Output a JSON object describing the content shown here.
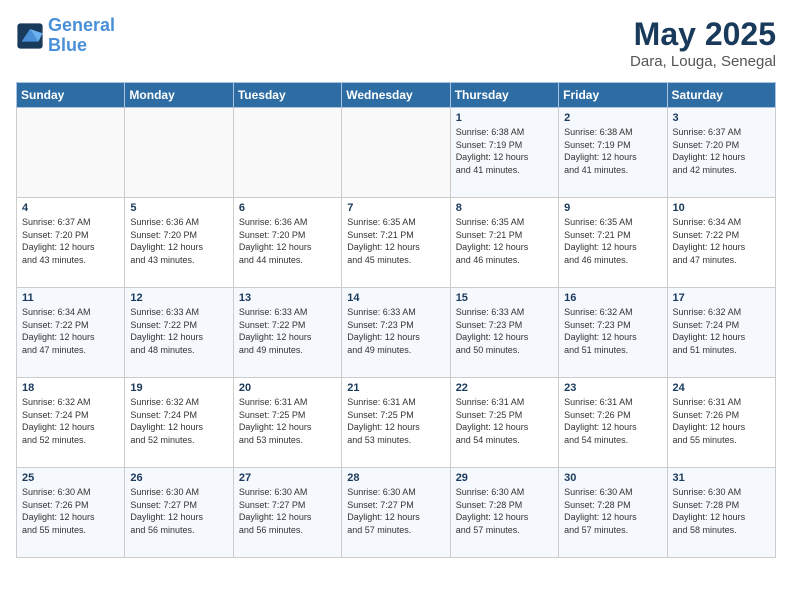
{
  "header": {
    "logo_line1": "General",
    "logo_line2": "Blue",
    "title": "May 2025",
    "subtitle": "Dara, Louga, Senegal"
  },
  "days_of_week": [
    "Sunday",
    "Monday",
    "Tuesday",
    "Wednesday",
    "Thursday",
    "Friday",
    "Saturday"
  ],
  "weeks": [
    [
      {
        "day": "",
        "info": ""
      },
      {
        "day": "",
        "info": ""
      },
      {
        "day": "",
        "info": ""
      },
      {
        "day": "",
        "info": ""
      },
      {
        "day": "1",
        "info": "Sunrise: 6:38 AM\nSunset: 7:19 PM\nDaylight: 12 hours\nand 41 minutes."
      },
      {
        "day": "2",
        "info": "Sunrise: 6:38 AM\nSunset: 7:19 PM\nDaylight: 12 hours\nand 41 minutes."
      },
      {
        "day": "3",
        "info": "Sunrise: 6:37 AM\nSunset: 7:20 PM\nDaylight: 12 hours\nand 42 minutes."
      }
    ],
    [
      {
        "day": "4",
        "info": "Sunrise: 6:37 AM\nSunset: 7:20 PM\nDaylight: 12 hours\nand 43 minutes."
      },
      {
        "day": "5",
        "info": "Sunrise: 6:36 AM\nSunset: 7:20 PM\nDaylight: 12 hours\nand 43 minutes."
      },
      {
        "day": "6",
        "info": "Sunrise: 6:36 AM\nSunset: 7:20 PM\nDaylight: 12 hours\nand 44 minutes."
      },
      {
        "day": "7",
        "info": "Sunrise: 6:35 AM\nSunset: 7:21 PM\nDaylight: 12 hours\nand 45 minutes."
      },
      {
        "day": "8",
        "info": "Sunrise: 6:35 AM\nSunset: 7:21 PM\nDaylight: 12 hours\nand 46 minutes."
      },
      {
        "day": "9",
        "info": "Sunrise: 6:35 AM\nSunset: 7:21 PM\nDaylight: 12 hours\nand 46 minutes."
      },
      {
        "day": "10",
        "info": "Sunrise: 6:34 AM\nSunset: 7:22 PM\nDaylight: 12 hours\nand 47 minutes."
      }
    ],
    [
      {
        "day": "11",
        "info": "Sunrise: 6:34 AM\nSunset: 7:22 PM\nDaylight: 12 hours\nand 47 minutes."
      },
      {
        "day": "12",
        "info": "Sunrise: 6:33 AM\nSunset: 7:22 PM\nDaylight: 12 hours\nand 48 minutes."
      },
      {
        "day": "13",
        "info": "Sunrise: 6:33 AM\nSunset: 7:22 PM\nDaylight: 12 hours\nand 49 minutes."
      },
      {
        "day": "14",
        "info": "Sunrise: 6:33 AM\nSunset: 7:23 PM\nDaylight: 12 hours\nand 49 minutes."
      },
      {
        "day": "15",
        "info": "Sunrise: 6:33 AM\nSunset: 7:23 PM\nDaylight: 12 hours\nand 50 minutes."
      },
      {
        "day": "16",
        "info": "Sunrise: 6:32 AM\nSunset: 7:23 PM\nDaylight: 12 hours\nand 51 minutes."
      },
      {
        "day": "17",
        "info": "Sunrise: 6:32 AM\nSunset: 7:24 PM\nDaylight: 12 hours\nand 51 minutes."
      }
    ],
    [
      {
        "day": "18",
        "info": "Sunrise: 6:32 AM\nSunset: 7:24 PM\nDaylight: 12 hours\nand 52 minutes."
      },
      {
        "day": "19",
        "info": "Sunrise: 6:32 AM\nSunset: 7:24 PM\nDaylight: 12 hours\nand 52 minutes."
      },
      {
        "day": "20",
        "info": "Sunrise: 6:31 AM\nSunset: 7:25 PM\nDaylight: 12 hours\nand 53 minutes."
      },
      {
        "day": "21",
        "info": "Sunrise: 6:31 AM\nSunset: 7:25 PM\nDaylight: 12 hours\nand 53 minutes."
      },
      {
        "day": "22",
        "info": "Sunrise: 6:31 AM\nSunset: 7:25 PM\nDaylight: 12 hours\nand 54 minutes."
      },
      {
        "day": "23",
        "info": "Sunrise: 6:31 AM\nSunset: 7:26 PM\nDaylight: 12 hours\nand 54 minutes."
      },
      {
        "day": "24",
        "info": "Sunrise: 6:31 AM\nSunset: 7:26 PM\nDaylight: 12 hours\nand 55 minutes."
      }
    ],
    [
      {
        "day": "25",
        "info": "Sunrise: 6:30 AM\nSunset: 7:26 PM\nDaylight: 12 hours\nand 55 minutes."
      },
      {
        "day": "26",
        "info": "Sunrise: 6:30 AM\nSunset: 7:27 PM\nDaylight: 12 hours\nand 56 minutes."
      },
      {
        "day": "27",
        "info": "Sunrise: 6:30 AM\nSunset: 7:27 PM\nDaylight: 12 hours\nand 56 minutes."
      },
      {
        "day": "28",
        "info": "Sunrise: 6:30 AM\nSunset: 7:27 PM\nDaylight: 12 hours\nand 57 minutes."
      },
      {
        "day": "29",
        "info": "Sunrise: 6:30 AM\nSunset: 7:28 PM\nDaylight: 12 hours\nand 57 minutes."
      },
      {
        "day": "30",
        "info": "Sunrise: 6:30 AM\nSunset: 7:28 PM\nDaylight: 12 hours\nand 57 minutes."
      },
      {
        "day": "31",
        "info": "Sunrise: 6:30 AM\nSunset: 7:28 PM\nDaylight: 12 hours\nand 58 minutes."
      }
    ]
  ]
}
